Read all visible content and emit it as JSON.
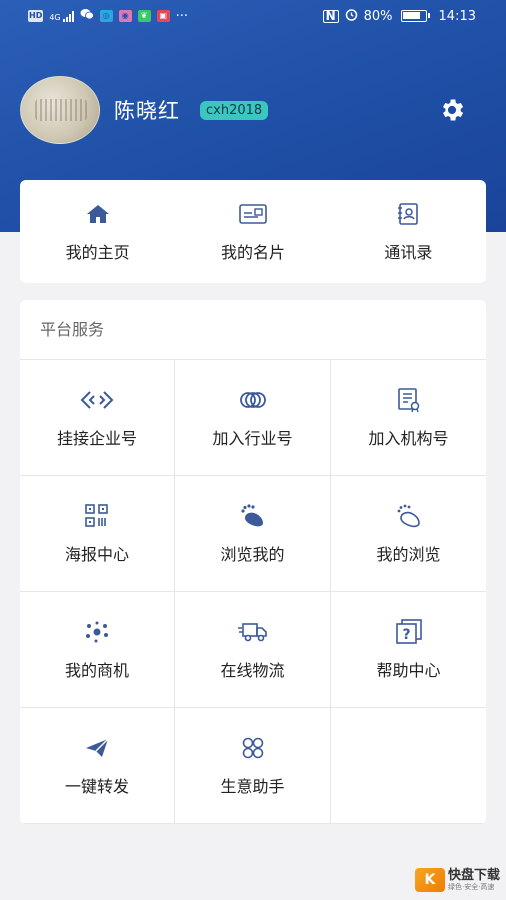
{
  "status_bar": {
    "left_items": [
      "HD",
      "4G",
      "wechat",
      "app",
      "app",
      "app",
      "app"
    ],
    "more": "···",
    "nfc": "N",
    "battery": "80%",
    "time": "14:13"
  },
  "profile": {
    "name": "陈晓红",
    "tag": "cxh2018",
    "settings_icon": "gear-icon"
  },
  "quick_links": [
    {
      "label": "我的主页",
      "icon": "home-icon"
    },
    {
      "label": "我的名片",
      "icon": "business-card-icon"
    },
    {
      "label": "通讯录",
      "icon": "contacts-icon"
    }
  ],
  "services": {
    "title": "平台服务",
    "items": [
      {
        "label": "挂接企业号",
        "icon": "link-icon"
      },
      {
        "label": "加入行业号",
        "icon": "rings-icon"
      },
      {
        "label": "加入机构号",
        "icon": "certificate-icon"
      },
      {
        "label": "海报中心",
        "icon": "qrcode-icon"
      },
      {
        "label": "浏览我的",
        "icon": "footprint-icon"
      },
      {
        "label": "我的浏览",
        "icon": "footprint-outline-icon"
      },
      {
        "label": "我的商机",
        "icon": "network-dots-icon"
      },
      {
        "label": "在线物流",
        "icon": "truck-icon"
      },
      {
        "label": "帮助中心",
        "icon": "help-icon"
      },
      {
        "label": "一键转发",
        "icon": "paper-plane-icon"
      },
      {
        "label": "生意助手",
        "icon": "clover-icon"
      }
    ]
  },
  "watermark": {
    "logo_char": "K",
    "main": "快盘下载",
    "sub": "绿色·安全·高速"
  },
  "colors": {
    "header_blue": "#2b5fb8",
    "icon_blue": "#3c5a9a",
    "tag_teal": "#3bc6c0"
  }
}
